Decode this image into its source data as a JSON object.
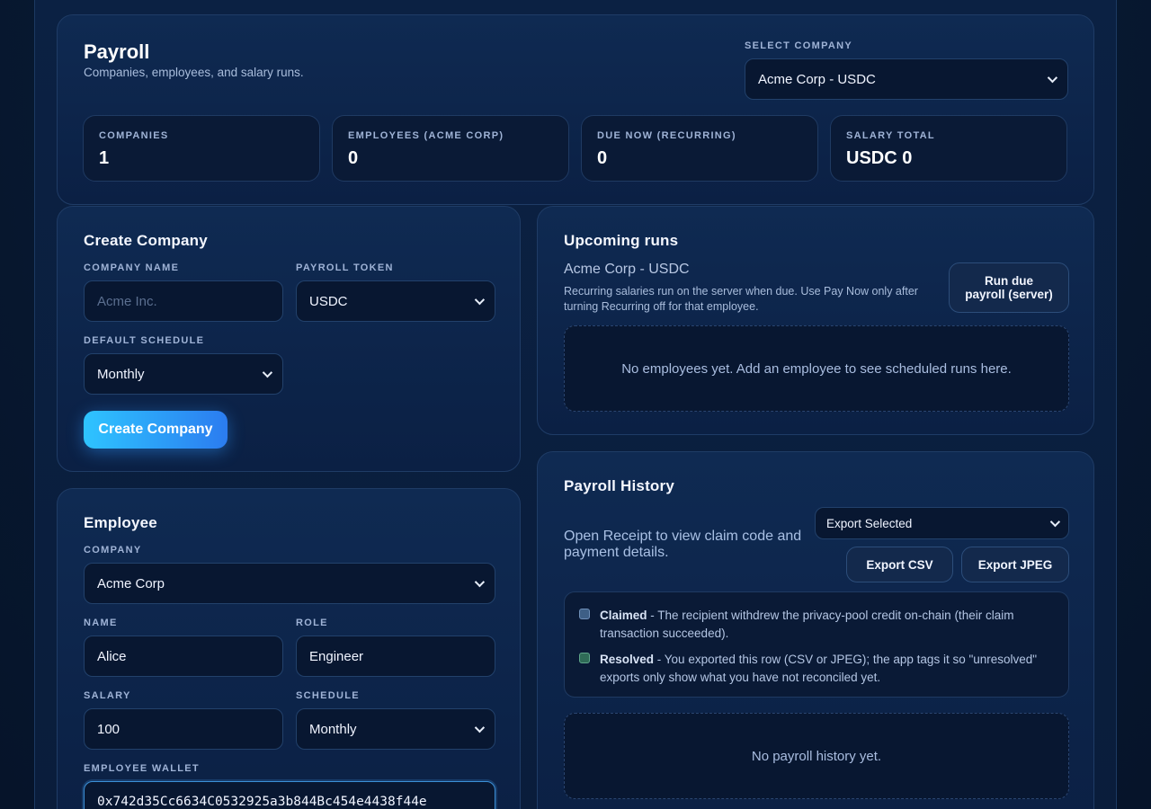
{
  "header": {
    "title": "Payroll",
    "subtitle": "Companies, employees, and salary runs.",
    "select_company_label": "SELECT COMPANY",
    "select_company_value": "Acme Corp - USDC"
  },
  "stats": [
    {
      "label": "COMPANIES",
      "value": "1"
    },
    {
      "label": "EMPLOYEES (ACME CORP)",
      "value": "0"
    },
    {
      "label": "DUE NOW (RECURRING)",
      "value": "0"
    },
    {
      "label": "SALARY TOTAL",
      "value": "USDC 0"
    }
  ],
  "create_company": {
    "title": "Create Company",
    "name_label": "COMPANY NAME",
    "name_placeholder": "Acme Inc.",
    "token_label": "PAYROLL TOKEN",
    "token_value": "USDC",
    "schedule_label": "DEFAULT SCHEDULE",
    "schedule_value": "Monthly",
    "button": "Create Company"
  },
  "employee": {
    "title": "Employee",
    "company_label": "COMPANY",
    "company_value": "Acme Corp",
    "name_label": "NAME",
    "name_value": "Alice",
    "role_label": "ROLE",
    "role_value": "Engineer",
    "salary_label": "SALARY",
    "salary_value": "100",
    "schedule_label": "SCHEDULE",
    "schedule_value": "Monthly",
    "wallet_label": "EMPLOYEE WALLET",
    "wallet_value": "0x742d35Cc6634C0532925a3b844Bc454e4438f44e"
  },
  "upcoming": {
    "title": "Upcoming runs",
    "company": "Acme Corp - USDC",
    "note": "Recurring salaries run on the server when due. Use Pay Now only after turning Recurring off for that employee.",
    "run_button": "Run due payroll (server)",
    "empty": "No employees yet. Add an employee to see scheduled runs here."
  },
  "history": {
    "title": "Payroll History",
    "hint": "Open Receipt to view claim code and payment details.",
    "export_select": "Export Selected",
    "export_csv": "Export CSV",
    "export_jpeg": "Export JPEG",
    "legend": [
      {
        "term": "Claimed",
        "text": " - The recipient withdrew the privacy-pool credit on-chain (their claim transaction succeeded).",
        "color": "#3e5f86"
      },
      {
        "term": "Resolved",
        "text": " - You exported this row (CSV or JPEG); the app tags it so \"unresolved\" exports only show what you have not reconciled yet.",
        "color": "#2f6b57"
      }
    ],
    "empty": "No payroll history yet."
  }
}
